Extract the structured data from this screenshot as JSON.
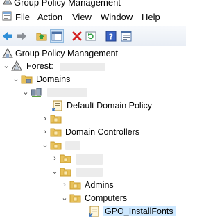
{
  "window": {
    "title": "Group Policy Management"
  },
  "menu": {
    "items": [
      {
        "label": "File"
      },
      {
        "label": "Action"
      },
      {
        "label": "View"
      },
      {
        "label": "Window"
      },
      {
        "label": "Help"
      }
    ]
  },
  "toolbar": {
    "buttons": [
      {
        "icon": "back-arrow-icon"
      },
      {
        "icon": "forward-arrow-icon"
      },
      {
        "icon": "up-folder-icon"
      },
      {
        "icon": "show-hide-tree-icon",
        "pressed": true
      },
      {
        "icon": "delete-icon"
      },
      {
        "icon": "refresh-icon"
      },
      {
        "icon": "help-icon"
      },
      {
        "icon": "properties-icon"
      }
    ]
  },
  "tree": {
    "root": {
      "label": "Group Policy Management"
    },
    "forest": {
      "label": "Forest:"
    },
    "domains": {
      "label": "Domains"
    },
    "default_domain_policy": {
      "label": "Default Domain Policy"
    },
    "domain_controllers": {
      "label": "Domain Controllers"
    },
    "admins": {
      "label": "Admins"
    },
    "computers": {
      "label": "Computers"
    },
    "gpo_install_fonts": {
      "label": "GPO_InstallFonts"
    }
  },
  "colors": {
    "folder": "#e8c15a",
    "folder_dark": "#c99b2c",
    "selection": "#cde8ff",
    "toolbar_arrow": "#2f8fd8",
    "delete_red": "#d42020",
    "refresh_green": "#2f9e44"
  }
}
